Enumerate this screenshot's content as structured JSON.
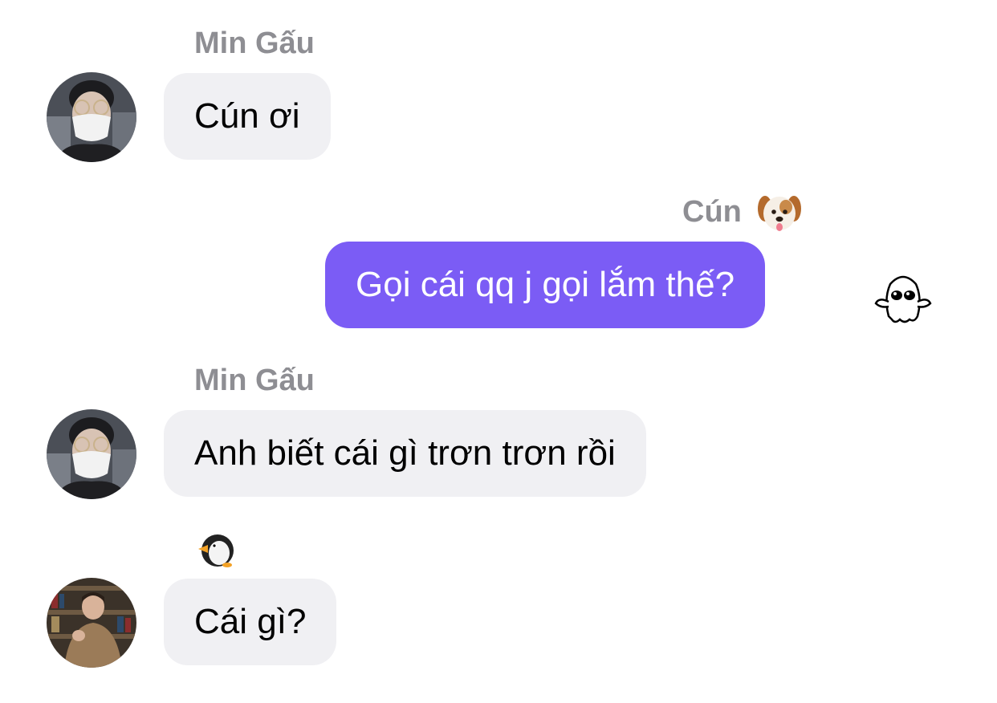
{
  "messages": [
    {
      "sender": "Min Gấu",
      "text": "Cún ơi",
      "direction": "incoming",
      "avatar": "avatar-mask-photo"
    },
    {
      "sender": "Cún",
      "sender_emoji": "dog-face-icon",
      "text": "Gọi cái qq j gọi lắm thế?",
      "direction": "outgoing",
      "read_receipt": "ghost-sticker-icon"
    },
    {
      "sender": "Min Gấu",
      "text": "Anh biết cái gì trơn trơn rồi",
      "direction": "incoming",
      "avatar": "avatar-mask-photo"
    },
    {
      "sender_emoji": "penguin-icon",
      "text": "Cái gì?",
      "direction": "incoming",
      "avatar": "avatar-library-photo"
    }
  ],
  "colors": {
    "incoming_bubble": "#f0f0f3",
    "outgoing_bubble": "#7b5cf5",
    "sender_name": "#8e8e93"
  }
}
